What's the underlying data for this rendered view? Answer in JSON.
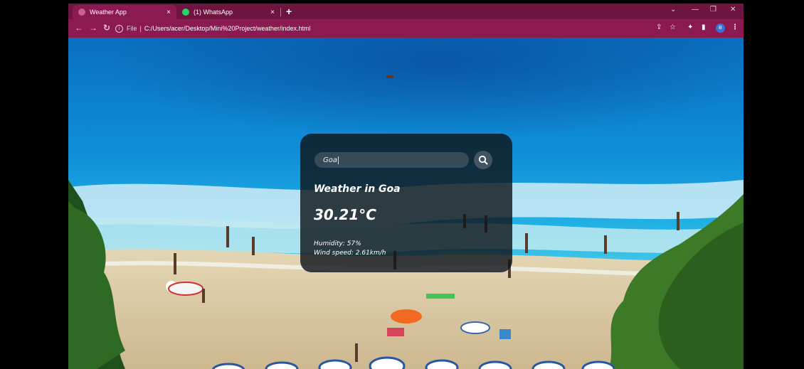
{
  "browser": {
    "tabs": [
      {
        "title": "Weather App",
        "active": true
      },
      {
        "title": "(1) WhatsApp",
        "active": false
      }
    ],
    "new_tab_icon": "+",
    "tab_close_icon": "×",
    "address": {
      "file_label": "File",
      "url": "C:/Users/acer/Desktop/Mini%20Project/weather/index.html"
    },
    "profile_initial": "B",
    "accent_color": "#8a1a50"
  },
  "weather": {
    "search_value": "Goa",
    "city_heading": "Weather in Goa",
    "temperature": "30.21°C",
    "humidity": "Humidity: 57%",
    "wind": "Wind speed: 2.61km/h"
  }
}
